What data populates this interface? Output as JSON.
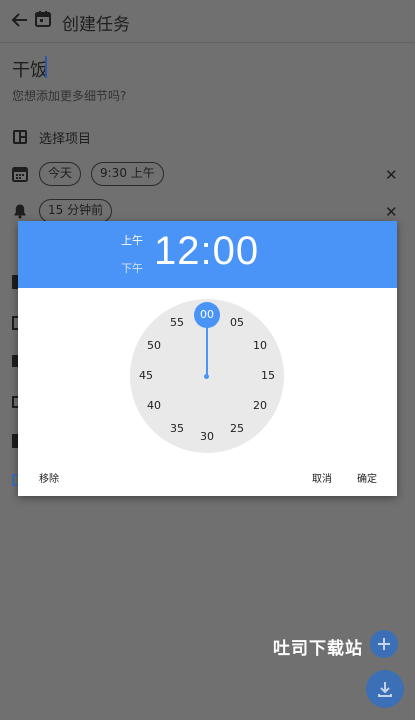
{
  "toolbar": {
    "title": "创建任务",
    "back_icon": "arrow-left-icon",
    "calendar_icon": "calendar-icon"
  },
  "task": {
    "title": "干饭",
    "hint": "您想添加更多细节吗?"
  },
  "project": {
    "label": "选择项目",
    "icon": "project-icon"
  },
  "date_row": {
    "icon": "calendar-icon",
    "day_chip": "今天",
    "time_chip": "9:30 上午",
    "clear": "✕"
  },
  "reminder_row": {
    "icon": "bell-icon",
    "chip": "15 分钟前",
    "clear": "✕"
  },
  "time_picker": {
    "am_label": "上午",
    "pm_label": "下午",
    "time": "12:00",
    "selected_minute": "00",
    "minutes": [
      "00",
      "05",
      "10",
      "15",
      "20",
      "25",
      "30",
      "35",
      "40",
      "45",
      "50",
      "55"
    ],
    "remove_label": "移除",
    "cancel_label": "取消",
    "ok_label": "确定",
    "accent_color": "#4a94f7"
  },
  "fab": {
    "add_icon": "plus-icon",
    "download_icon": "download-icon"
  },
  "watermark": "吐司下载站"
}
